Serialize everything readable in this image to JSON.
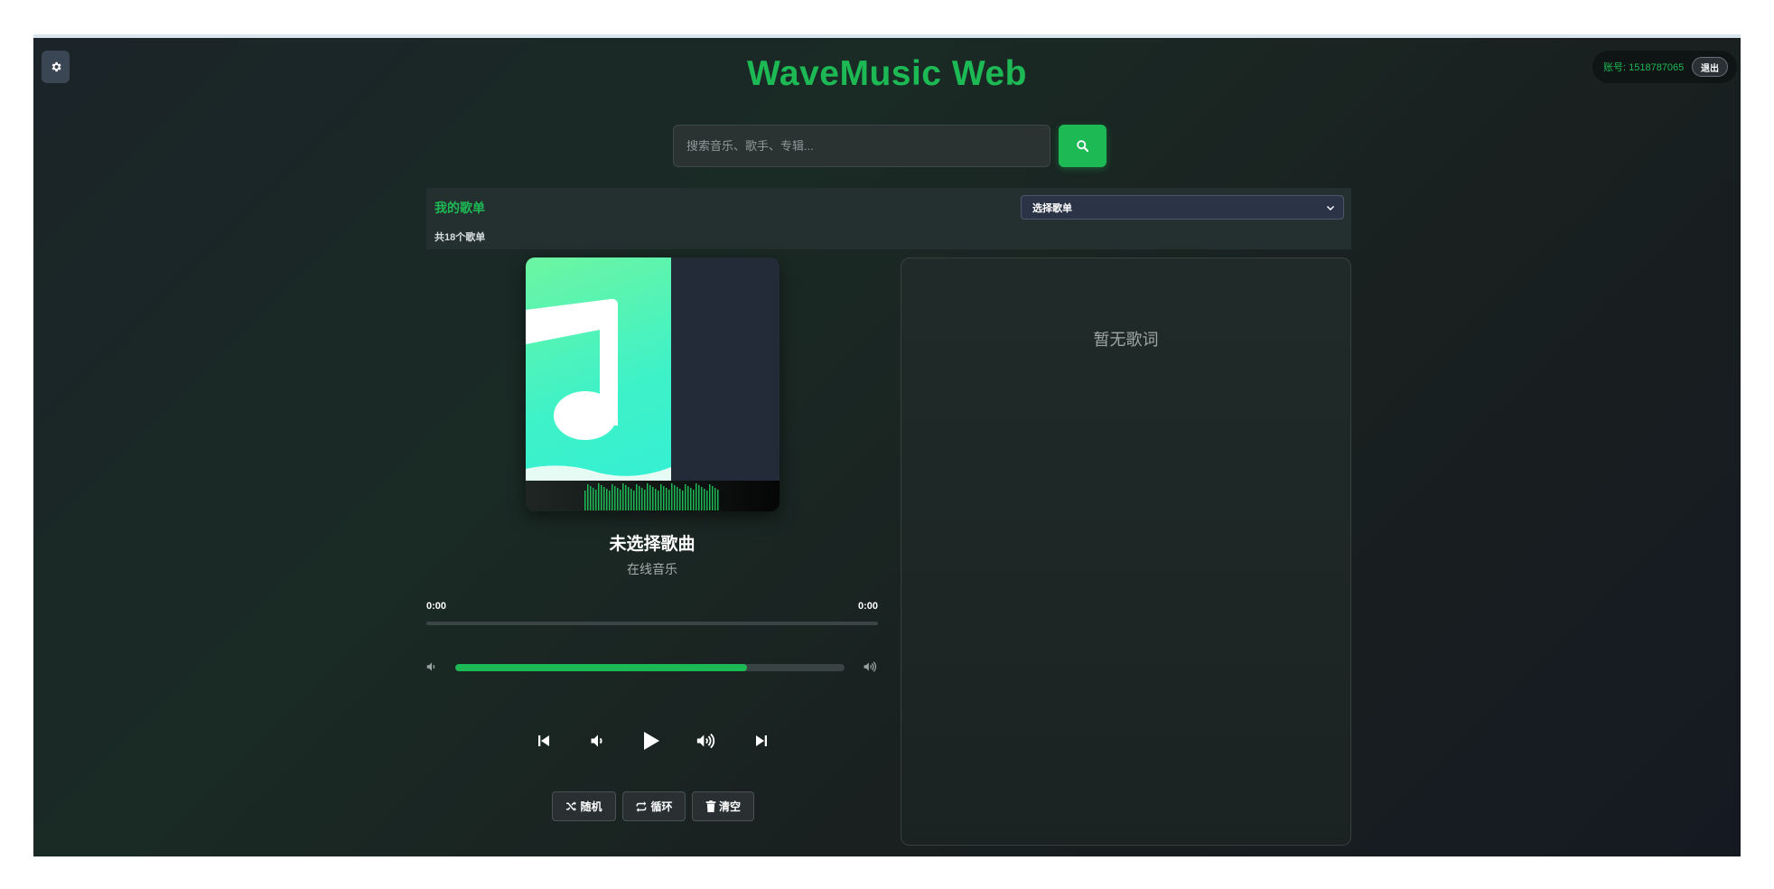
{
  "app": {
    "title": "WaveMusic Web"
  },
  "account": {
    "label": "账号: 1518787065",
    "logout_label": "退出"
  },
  "search": {
    "placeholder": "搜索音乐、歌手、专辑..."
  },
  "playlist": {
    "title": "我的歌单",
    "count_text": "共18个歌单",
    "select_value": "选择歌单"
  },
  "now_playing": {
    "song_title": "未选择歌曲",
    "subtitle": "在线音乐",
    "current_time": "0:00",
    "duration": "0:00",
    "progress": 0,
    "volume": 0.75
  },
  "modes": {
    "shuffle_label": "随机",
    "loop_label": "循环",
    "clear_label": "清空"
  },
  "lyrics": {
    "empty_text": "暂无歌词"
  },
  "colors": {
    "accent": "#1db954",
    "background": "#1a2422"
  },
  "icons": [
    "gear-icon",
    "search-icon",
    "chevron-down-icon",
    "music-note-icon",
    "volume-down-icon",
    "volume-up-icon",
    "skip-back-icon",
    "play-icon",
    "skip-forward-icon",
    "shuffle-icon",
    "repeat-icon",
    "trash-icon"
  ]
}
